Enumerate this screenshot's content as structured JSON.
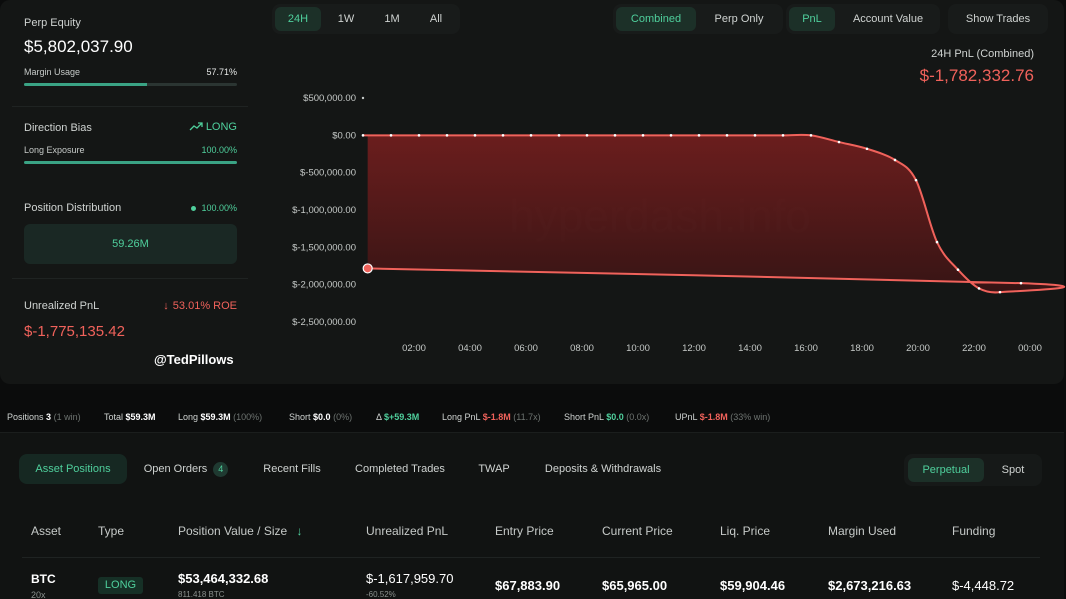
{
  "summary": {
    "equity_label": "Perp Equity",
    "equity_value": "$5,802,037.90",
    "margin_label": "Margin Usage",
    "margin_pct": "57.71%",
    "margin_fraction": 0.5771,
    "bias_label": "Direction Bias",
    "bias_value": "LONG",
    "long_exposure_label": "Long Exposure",
    "long_exposure_pct": "100.00%",
    "long_exposure_fraction": 1.0,
    "distribution_label": "Position Distribution",
    "distribution_pct": "100.00%",
    "distribution_value": "59.26M",
    "upnl_label": "Unrealized PnL",
    "roe": "53.01% ROE",
    "upnl_value": "$-1,775,135.42",
    "handle": "@TedPillows"
  },
  "controls": {
    "ranges": [
      "24H",
      "1W",
      "1M",
      "All"
    ],
    "scope": [
      "Combined",
      "Perp Only"
    ],
    "metric": [
      "PnL",
      "Account Value"
    ],
    "show_trades": "Show Trades"
  },
  "chart_header": {
    "title": "24H PnL (Combined)",
    "value": "$-1,782,332.76"
  },
  "watermark": "hyperdash.info",
  "chart_data": {
    "type": "area",
    "title": "24H PnL (Combined)",
    "x": [
      "01:00",
      "02:00",
      "03:00",
      "04:00",
      "05:00",
      "06:00",
      "07:00",
      "08:00",
      "09:00",
      "10:00",
      "11:00",
      "12:00",
      "13:00",
      "14:00",
      "15:00",
      "16:00",
      "17:00",
      "18:00",
      "19:00",
      "20:00",
      "20:45",
      "21:30",
      "22:15",
      "23:00",
      "23:45",
      "00:30",
      "01:10"
    ],
    "values": [
      0,
      0,
      0,
      0,
      0,
      0,
      0,
      0,
      0,
      0,
      0,
      0,
      0,
      0,
      0,
      0,
      0,
      -90000,
      -180000,
      -330000,
      -600000,
      -1430000,
      -1800000,
      -2050000,
      -2100000,
      -1980000,
      -1782332.76
    ],
    "x_ticks": [
      "02:00",
      "04:00",
      "06:00",
      "08:00",
      "10:00",
      "12:00",
      "14:00",
      "16:00",
      "18:00",
      "20:00",
      "22:00",
      "00:00"
    ],
    "y_ticks": [
      "$500,000.00",
      "$0.00",
      "$-500,000.00",
      "$-1,000,000.00",
      "$-1,500,000.00",
      "$-2,000,000.00",
      "$-2,500,000.00"
    ],
    "ylim": [
      -2500000,
      500000
    ],
    "colors": {
      "line": "#f0625b",
      "fill": "#7a1f1f"
    }
  },
  "stats": {
    "positions_label": "Positions",
    "positions": "3",
    "positions_note": "(1 win)",
    "total_label": "Total",
    "total": "$59.3M",
    "long_label": "Long",
    "long": "$59.3M",
    "long_note": "(100%)",
    "short_label": "Short",
    "short": "$0.0",
    "short_note": "(0%)",
    "delta_label": "Δ",
    "delta": "$+59.3M",
    "long_pnl_label": "Long PnL",
    "long_pnl": "$-1.8M",
    "long_pnl_note": "(11.7x)",
    "short_pnl_label": "Short PnL",
    "short_pnl": "$0.0",
    "short_pnl_note": "(0.0x)",
    "upnl_label": "UPnL",
    "upnl": "$-1.8M",
    "upnl_note": "(33% win)"
  },
  "tabs": {
    "items": [
      "Asset Positions",
      "Open Orders",
      "Recent Fills",
      "Completed Trades",
      "TWAP",
      "Deposits & Withdrawals"
    ],
    "open_orders_count": "4",
    "market": [
      "Perpetual",
      "Spot"
    ]
  },
  "table": {
    "headers": [
      "Asset",
      "Type",
      "Position Value / Size",
      "Unrealized PnL",
      "Entry Price",
      "Current Price",
      "Liq. Price",
      "Margin Used",
      "Funding"
    ],
    "sort_arrow": "↓",
    "rows": [
      {
        "asset": "BTC",
        "leverage": "20x",
        "type": "LONG",
        "value": "$53,464,332.68",
        "size": "811.418 BTC",
        "upnl": "$-1,617,959.70",
        "upnl_pct": "-60.52%",
        "entry": "$67,883.90",
        "current": "$65,965.00",
        "liq": "$59,904.46",
        "margin": "$2,673,216.63",
        "funding": "$-4,448.72"
      }
    ]
  }
}
